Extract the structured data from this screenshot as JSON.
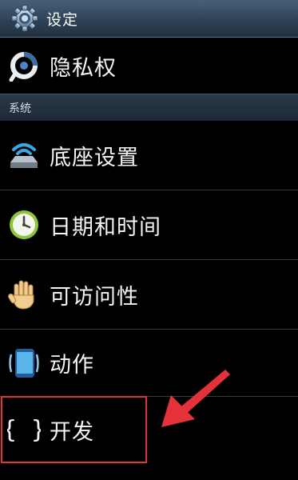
{
  "header": {
    "title": "设定",
    "icon": "gear-icon"
  },
  "items_top": [
    {
      "label": "隐私权",
      "icon": "privacy-icon"
    }
  ],
  "section": {
    "label": "系统"
  },
  "system_items": [
    {
      "label": "底座设置",
      "icon": "dock-icon"
    },
    {
      "label": "日期和时间",
      "icon": "clock-icon"
    },
    {
      "label": "可访问性",
      "icon": "hand-icon"
    },
    {
      "label": "动作",
      "icon": "phone-motion-icon"
    },
    {
      "label": "开发",
      "icon": "braces-icon"
    }
  ],
  "colors": {
    "highlight": "#e5323a",
    "arrow": "#e5323a",
    "title_bar": "#2e4257"
  }
}
